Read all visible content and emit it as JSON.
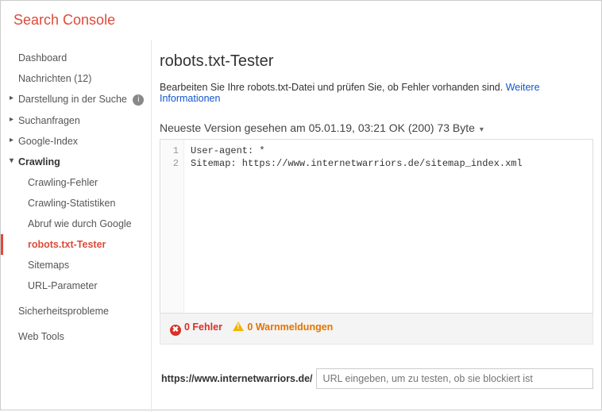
{
  "header": {
    "logo": "Search Console"
  },
  "sidebar": {
    "dashboard": "Dashboard",
    "messages": "Nachrichten (12)",
    "appearance": "Darstellung in der Suche",
    "search_queries": "Suchanfragen",
    "google_index": "Google-Index",
    "crawling": "Crawling",
    "crawling_children": {
      "errors": "Crawling-Fehler",
      "stats": "Crawling-Statistiken",
      "fetch": "Abruf wie durch Google",
      "tester": "robots.txt-Tester",
      "sitemaps": "Sitemaps",
      "url_params": "URL-Parameter"
    },
    "security": "Sicherheitsprobleme",
    "web_tools": "Web Tools"
  },
  "main": {
    "title": "robots.txt-Tester",
    "intro_text": "Bearbeiten Sie Ihre robots.txt-Datei und prüfen Sie, ob Fehler vorhanden sind. ",
    "intro_link": "Weitere Informationen",
    "version_line": "Neueste Version gesehen am 05.01.19, 03:21 OK (200) 73 Byte",
    "code_lines": {
      "l1": "User-agent: *",
      "l2": "Sitemap: https://www.internetwarriors.de/sitemap_index.xml"
    },
    "status": {
      "errors": "0 Fehler",
      "warnings": "0 Warnmeldungen"
    },
    "url_test": {
      "prefix": "https://www.internetwarriors.de/",
      "placeholder": "URL eingeben, um zu testen, ob sie blockiert ist"
    }
  }
}
